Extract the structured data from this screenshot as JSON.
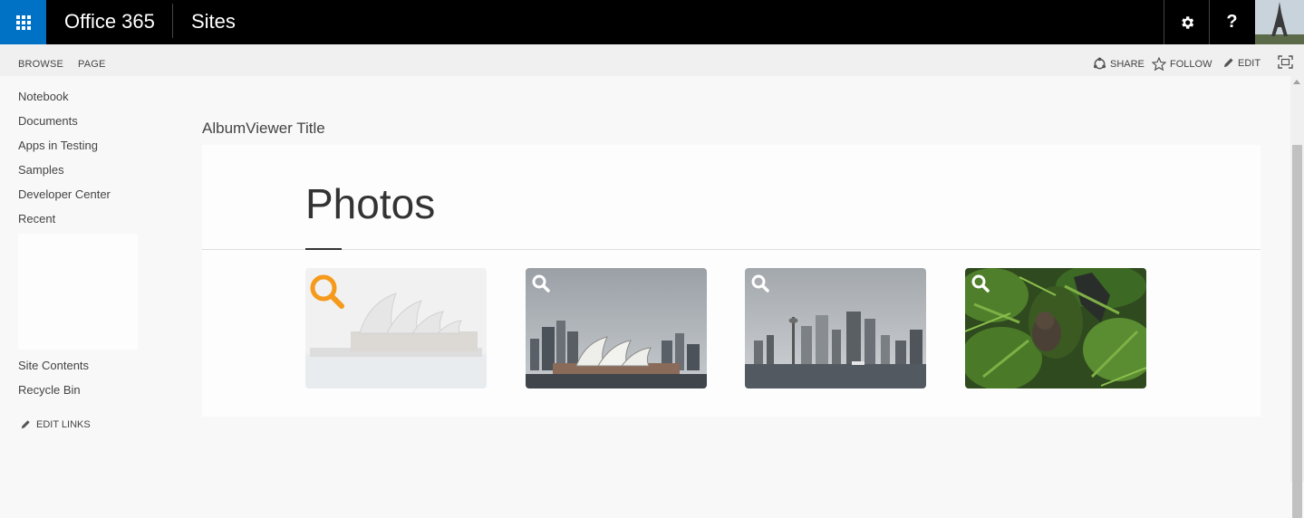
{
  "suite_bar": {
    "brand": "Office 365",
    "site_label": "Sites",
    "settings_icon": "gear-icon",
    "help_label": "?",
    "app_launcher_icon": "waffle-icon",
    "accent_color": "#0072c6"
  },
  "ribbon": {
    "tabs": [
      "BROWSE",
      "PAGE"
    ],
    "actions": {
      "share": "SHARE",
      "follow": "FOLLOW",
      "edit": "EDIT"
    },
    "focus_icon": "focus-mode-icon"
  },
  "left_nav": {
    "items": [
      "Notebook",
      "Documents",
      "Apps in Testing",
      "Samples",
      "Developer Center",
      "Recent"
    ],
    "bottom_items": [
      "Site Contents",
      "Recycle Bin"
    ],
    "edit_links": "EDIT LINKS"
  },
  "content": {
    "title": "AlbumViewer Title",
    "heading": "Photos",
    "photos": [
      {
        "subject": "opera-house-faded",
        "highlighted": true
      },
      {
        "subject": "opera-house-skyline"
      },
      {
        "subject": "city-skyline"
      },
      {
        "subject": "koala-in-tree"
      }
    ],
    "search_icon_color_active": "#f59a1b"
  }
}
